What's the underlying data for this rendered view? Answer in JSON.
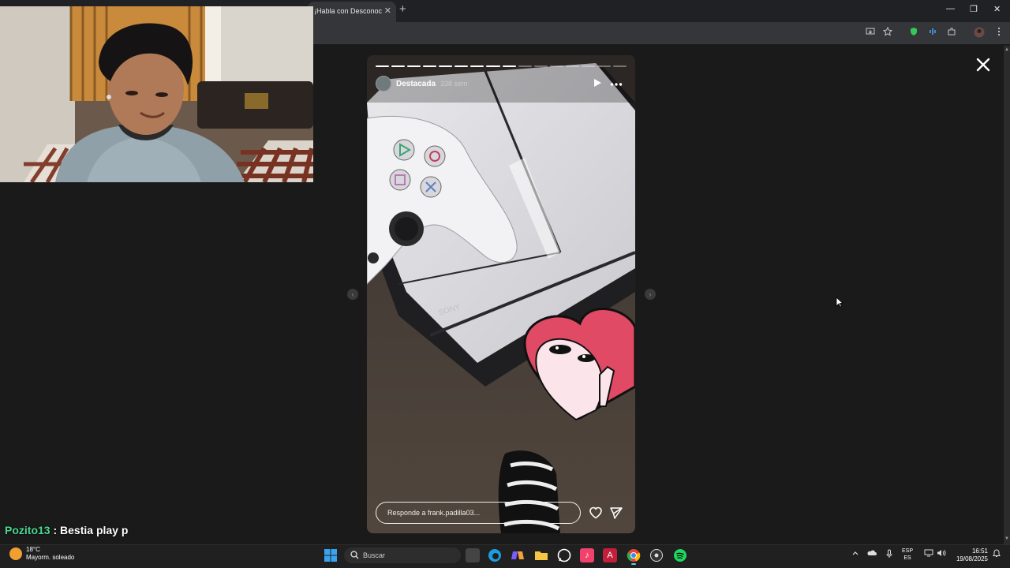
{
  "browser": {
    "tab_title": "¡Habla con Desconoc",
    "tab_close": "✕",
    "new_tab": "+",
    "window_controls": {
      "minimize": "—",
      "maximize": "❐",
      "close": "✕"
    }
  },
  "story": {
    "username": "Destacada",
    "time": "338 sem",
    "segments_total": 16,
    "segments_done": 9,
    "reply_placeholder": "Responde a frank.padilla03...",
    "prev_arrow": "‹",
    "next_arrow": "›"
  },
  "chat": {
    "user": "Pozito13",
    "separator": " : ",
    "message": "Bestia play p"
  },
  "taskbar": {
    "weather_temp": "18°C",
    "weather_desc": "Mayorm. soleado",
    "search_label": "Buscar",
    "lang_top": "ESP",
    "lang_bottom": "ES",
    "time": "16:51",
    "date": "19/08/2025"
  },
  "colors": {
    "chat_user": "#4ad98e",
    "heart": "#e04a64",
    "taskbar_accent": "#60cdff"
  }
}
